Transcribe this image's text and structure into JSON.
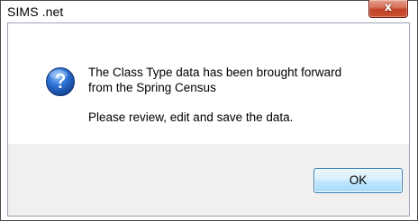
{
  "window": {
    "title": "SIMS .net",
    "close_glyph": "x"
  },
  "message": {
    "icon": "question-icon",
    "line1": "The Class Type data has been brought forward",
    "line2": "from the Spring Census",
    "line3": "Please review, edit and save the data."
  },
  "buttons": {
    "ok_label": "OK"
  },
  "colors": {
    "close_button": "#c8522f",
    "icon_blue": "#1f5fb8",
    "button_area": "#f0f0f0"
  }
}
